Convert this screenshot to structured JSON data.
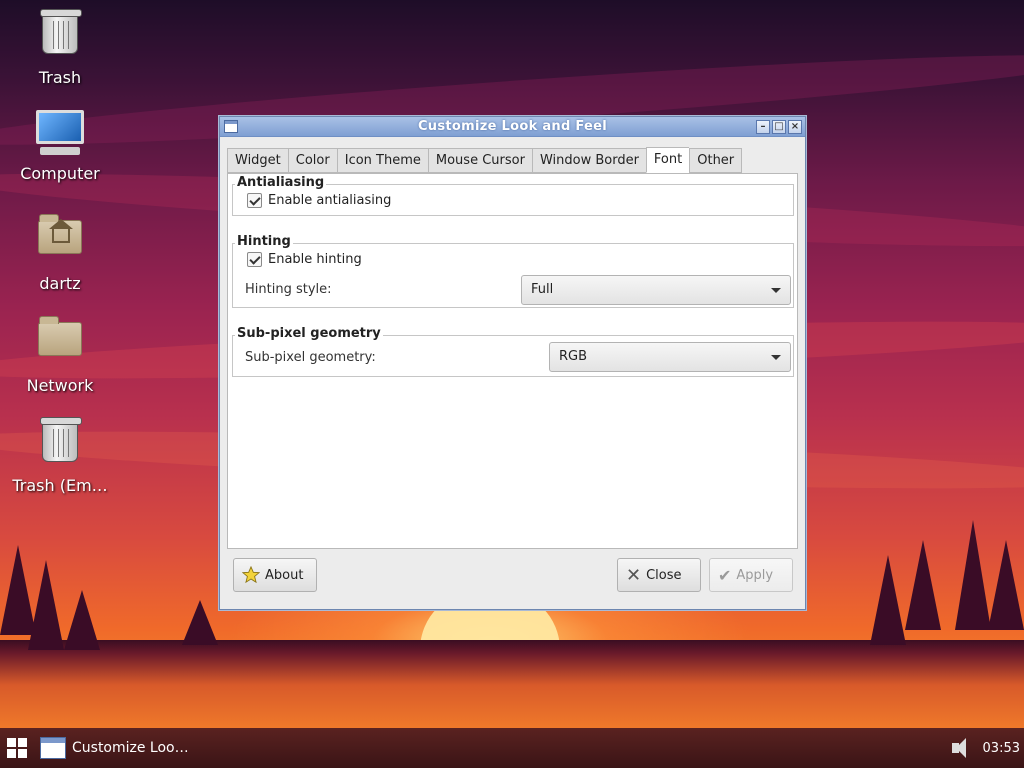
{
  "desktop": {
    "icons": [
      {
        "label": "Trash",
        "icon": "trash-icon"
      },
      {
        "label": "Computer",
        "icon": "computer-icon"
      },
      {
        "label": "dartz",
        "icon": "home-folder-icon"
      },
      {
        "label": "Network",
        "icon": "folder-icon"
      },
      {
        "label": "Trash (Em…",
        "icon": "trash-icon"
      }
    ]
  },
  "window": {
    "title": "Customize Look and Feel",
    "controls": {
      "minimize": "–",
      "maximize": "□",
      "close": "×"
    },
    "tabs": [
      {
        "label": "Widget"
      },
      {
        "label": "Color"
      },
      {
        "label": "Icon Theme"
      },
      {
        "label": "Mouse Cursor"
      },
      {
        "label": "Window Border"
      },
      {
        "label": "Font",
        "active": true
      },
      {
        "label": "Other"
      }
    ],
    "antialiasing": {
      "title": "Antialiasing",
      "enable_label": "Enable antialiasing",
      "enabled": true
    },
    "hinting": {
      "title": "Hinting",
      "enable_label": "Enable hinting",
      "enabled": true,
      "style_label": "Hinting style:",
      "style_value": "Full"
    },
    "subpixel": {
      "title": "Sub-pixel geometry",
      "label": "Sub-pixel geometry:",
      "value": "RGB"
    },
    "buttons": {
      "about": "About",
      "close": "Close",
      "apply": "Apply"
    }
  },
  "taskbar": {
    "task_label": "Customize Loo…",
    "clock": "03:53"
  }
}
